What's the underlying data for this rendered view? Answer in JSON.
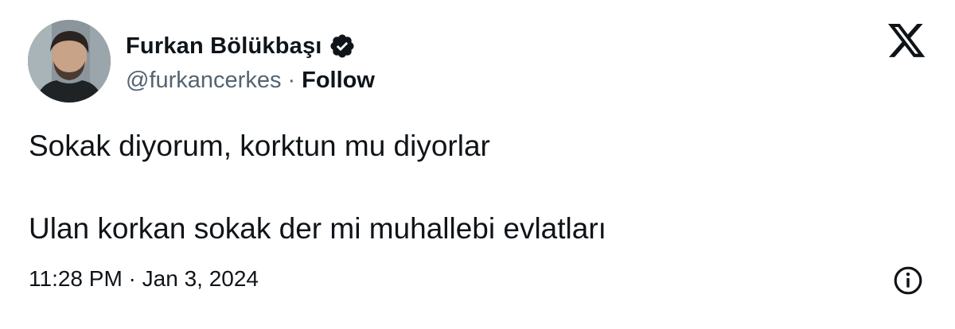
{
  "author": {
    "display_name": "Furkan Bölükbaşı",
    "handle": "@furkancerkes",
    "separator": "·",
    "follow_label": "Follow",
    "avatar_icon": "profile-photo",
    "verified_icon": "verified-badge-icon"
  },
  "brand": {
    "logo_icon": "x-logo-icon"
  },
  "tweet": {
    "line1": "Sokak diyorum, korktun mu diyorlar",
    "line2": "Ulan korkan sokak der mi muhallebi evlatları",
    "timestamp": "11:28 PM · Jan 3, 2024"
  },
  "footer": {
    "info_icon": "info-icon"
  },
  "colors": {
    "text": "#0f1419",
    "secondary": "#536471",
    "background": "#ffffff"
  }
}
